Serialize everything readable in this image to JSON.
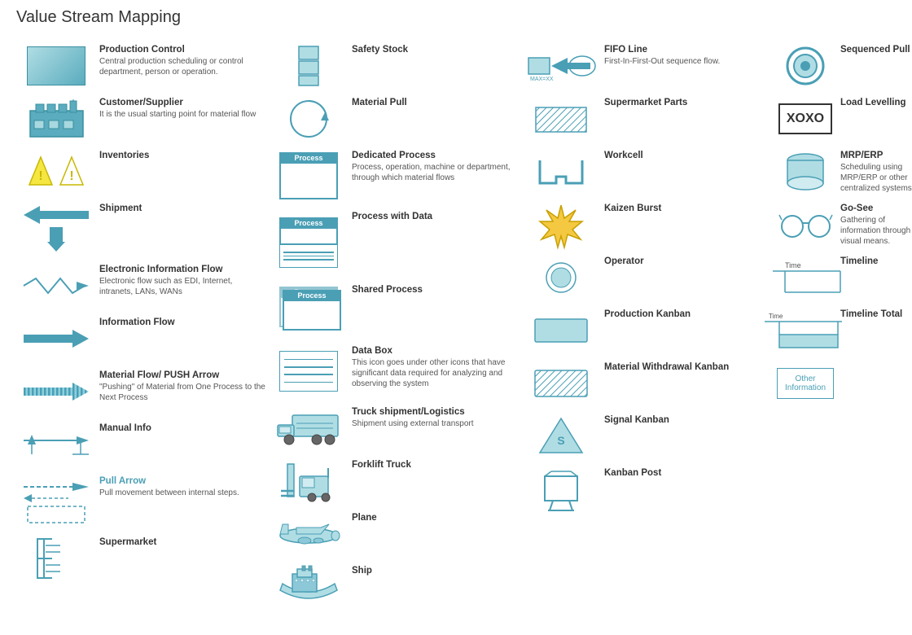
{
  "title": "Value Stream Mapping",
  "items": [
    {
      "col": 0,
      "label": "Production Control",
      "desc": "Central production scheduling or control department, person or operation.",
      "icon": "production-control"
    },
    {
      "col": 0,
      "label": "Customer/Supplier",
      "desc": "It is the usual starting point for material flow",
      "icon": "customer-supplier"
    },
    {
      "col": 0,
      "label": "Inventories",
      "desc": "",
      "icon": "inventories"
    },
    {
      "col": 0,
      "label": "Shipment",
      "desc": "",
      "icon": "shipment"
    },
    {
      "col": 0,
      "label": "Electronic Information Flow",
      "desc": "Electronic flow such as EDI, Internet, intranets, LANs, WANs",
      "icon": "electronic-info-flow"
    },
    {
      "col": 0,
      "label": "Information Flow",
      "desc": "",
      "icon": "info-flow"
    },
    {
      "col": 0,
      "label": "Material Flow/ PUSH Arrow",
      "desc": "\"Pushing\" of Material from One Process to the Next Process",
      "icon": "push-arrow"
    },
    {
      "col": 0,
      "label": "Manual Info",
      "desc": "",
      "icon": "manual-info"
    },
    {
      "col": 0,
      "label": "Pull Arrow",
      "desc": "Pull movement between internal steps.",
      "icon": "pull-arrow"
    },
    {
      "col": 0,
      "label": "Supermarket",
      "desc": "",
      "icon": "supermarket"
    },
    {
      "col": 1,
      "label": "Safety Stock",
      "desc": "",
      "icon": "safety-stock"
    },
    {
      "col": 1,
      "label": "Material Pull",
      "desc": "",
      "icon": "material-pull"
    },
    {
      "col": 1,
      "label": "Dedicated Process",
      "desc": "Process, operation, machine or department, through which material flows",
      "icon": "dedicated-process"
    },
    {
      "col": 1,
      "label": "Process with Data",
      "desc": "",
      "icon": "process-with-data"
    },
    {
      "col": 1,
      "label": "Shared Process",
      "desc": "",
      "icon": "shared-process"
    },
    {
      "col": 1,
      "label": "Data Box",
      "desc": "This icon goes under other icons that have significant data required for analyzing and observing the system",
      "icon": "data-box"
    },
    {
      "col": 1,
      "label": "Truck shipment/Logistics",
      "desc": "Shipment using external transport",
      "icon": "truck"
    },
    {
      "col": 1,
      "label": "Forklift Truck",
      "desc": "",
      "icon": "forklift"
    },
    {
      "col": 1,
      "label": "Plane",
      "desc": "",
      "icon": "plane"
    },
    {
      "col": 1,
      "label": "Ship",
      "desc": "",
      "icon": "ship"
    },
    {
      "col": 2,
      "label": "FIFO Line",
      "desc": "First-In-First-Out sequence flow.",
      "icon": "fifo-line"
    },
    {
      "col": 2,
      "label": "Supermarket Parts",
      "desc": "",
      "icon": "supermarket-parts"
    },
    {
      "col": 2,
      "label": "Workcell",
      "desc": "",
      "icon": "workcell"
    },
    {
      "col": 2,
      "label": "Kaizen Burst",
      "desc": "",
      "icon": "kaizen-burst"
    },
    {
      "col": 2,
      "label": "Operator",
      "desc": "",
      "icon": "operator"
    },
    {
      "col": 2,
      "label": "Production Kanban",
      "desc": "",
      "icon": "production-kanban"
    },
    {
      "col": 2,
      "label": "Material Withdrawal Kanban",
      "desc": "",
      "icon": "material-withdrawal-kanban"
    },
    {
      "col": 2,
      "label": "Signal Kanban",
      "desc": "",
      "icon": "signal-kanban"
    },
    {
      "col": 2,
      "label": "Kanban Post",
      "desc": "",
      "icon": "kanban-post"
    },
    {
      "col": 3,
      "label": "Sequenced Pull",
      "desc": "",
      "icon": "sequenced-pull"
    },
    {
      "col": 3,
      "label": "Load Levelling",
      "desc": "",
      "icon": "load-levelling"
    },
    {
      "col": 3,
      "label": "MRP/ERP",
      "desc": "Scheduling using MRP/ERP or other centralized systems.",
      "icon": "mrp-erp"
    },
    {
      "col": 3,
      "label": "Go-See",
      "desc": "Gathering of information through visual means.",
      "icon": "go-see"
    },
    {
      "col": 3,
      "label": "Timeline",
      "desc": "",
      "icon": "timeline"
    },
    {
      "col": 3,
      "label": "Timeline Total",
      "desc": "",
      "icon": "timeline-total"
    },
    {
      "col": 3,
      "label": "Other Information",
      "desc": "",
      "icon": "other-information"
    }
  ]
}
